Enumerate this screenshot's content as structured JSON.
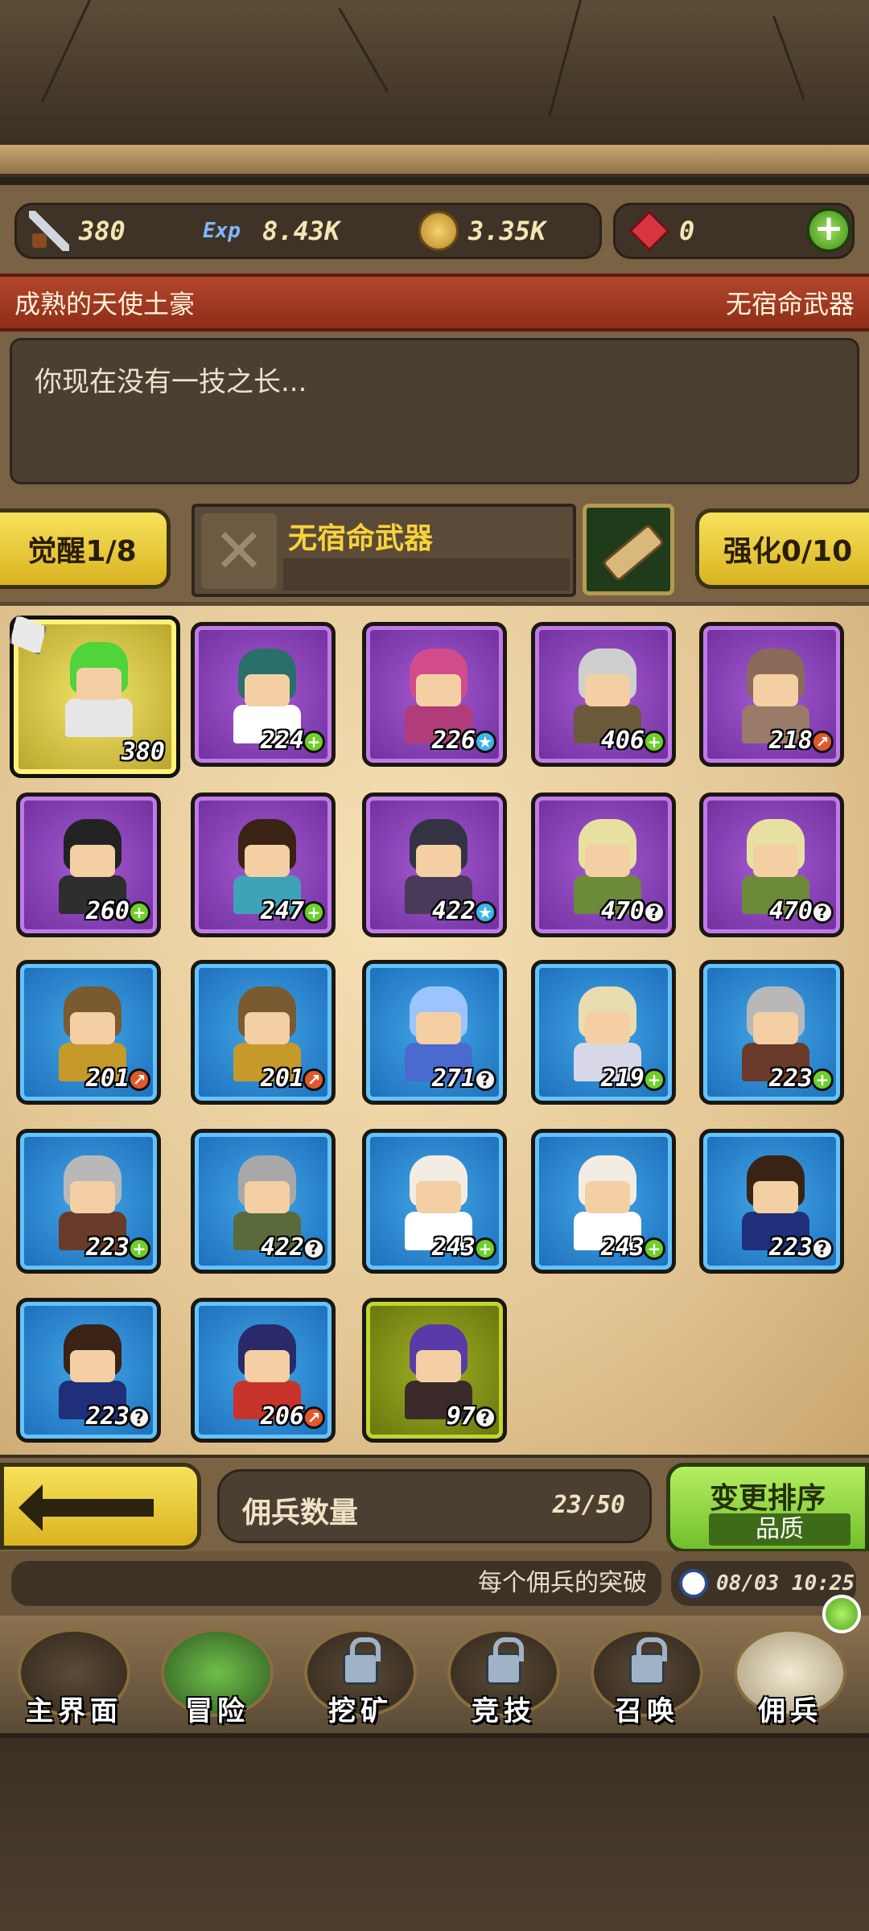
{
  "resources": {
    "power": "380",
    "exp_icon_text": "Exp",
    "exp": "8.43K",
    "gold": "3.35K",
    "gems": "0",
    "add_label": "+"
  },
  "hero": {
    "name": "成熟的天使土豪",
    "weapon_status": "无宿命武器",
    "description": "你现在没有一技之长..."
  },
  "actions": {
    "awaken_label": "觉醒1/8",
    "weapon_name": "无宿命武器",
    "weapon_empty_symbol": "✕",
    "enhance_label": "强化0/10"
  },
  "mercenaries": [
    {
      "level": "380",
      "rarity": "gold",
      "badge": "none",
      "hair": "#4fd43a",
      "outfit": "#e6e6e6"
    },
    {
      "level": "224",
      "rarity": "purple",
      "badge": "plus",
      "hair": "#2a6f6a",
      "outfit": "#ffffff"
    },
    {
      "level": "226",
      "rarity": "purple",
      "badge": "star",
      "hair": "#d24c8c",
      "outfit": "#b03d7a"
    },
    {
      "level": "406",
      "rarity": "purple",
      "badge": "plus",
      "hair": "#cfcfcf",
      "outfit": "#6a5a3a"
    },
    {
      "level": "218",
      "rarity": "purple",
      "badge": "leaf",
      "hair": "#8a6a5a",
      "outfit": "#9a7a68"
    },
    {
      "level": "260",
      "rarity": "purple",
      "badge": "plus",
      "hair": "#222222",
      "outfit": "#2e2e2e"
    },
    {
      "level": "247",
      "rarity": "purple",
      "badge": "plus",
      "hair": "#3a2214",
      "outfit": "#3fa3b8"
    },
    {
      "level": "422",
      "rarity": "purple",
      "badge": "star",
      "hair": "#333344",
      "outfit": "#4a3a5a"
    },
    {
      "level": "470",
      "rarity": "purple",
      "badge": "q",
      "hair": "#e8e0a0",
      "outfit": "#6c8a3a"
    },
    {
      "level": "470",
      "rarity": "purple",
      "badge": "q",
      "hair": "#e8e0a0",
      "outfit": "#6c8a3a"
    },
    {
      "level": "201",
      "rarity": "blue",
      "badge": "leaf",
      "hair": "#7a5a30",
      "outfit": "#c59a2a"
    },
    {
      "level": "201",
      "rarity": "blue",
      "badge": "leaf",
      "hair": "#7a5a30",
      "outfit": "#c59a2a"
    },
    {
      "level": "271",
      "rarity": "blue",
      "badge": "q",
      "hair": "#9cc4ff",
      "outfit": "#4a6ad0"
    },
    {
      "level": "219",
      "rarity": "blue",
      "badge": "plus",
      "hair": "#e8dcb0",
      "outfit": "#d8d8e8"
    },
    {
      "level": "223",
      "rarity": "blue",
      "badge": "plus",
      "hair": "#b8b8b8",
      "outfit": "#6a3a2a"
    },
    {
      "level": "223",
      "rarity": "blue",
      "badge": "plus",
      "hair": "#b8b8b8",
      "outfit": "#6a3a2a"
    },
    {
      "level": "422",
      "rarity": "blue",
      "badge": "q",
      "hair": "#a8a8a8",
      "outfit": "#5a6a3a"
    },
    {
      "level": "243",
      "rarity": "blue",
      "badge": "plus",
      "hair": "#f2ece2",
      "outfit": "#ffffff"
    },
    {
      "level": "243",
      "rarity": "blue",
      "badge": "plus",
      "hair": "#f2ece2",
      "outfit": "#ffffff"
    },
    {
      "level": "223",
      "rarity": "blue",
      "badge": "q",
      "hair": "#3a2214",
      "outfit": "#1f2f7a"
    },
    {
      "level": "223",
      "rarity": "blue",
      "badge": "q",
      "hair": "#3a2214",
      "outfit": "#1f2f7a"
    },
    {
      "level": "206",
      "rarity": "blue",
      "badge": "leaf",
      "hair": "#2a2a6a",
      "outfit": "#c8342a"
    },
    {
      "level": "97",
      "rarity": "olive",
      "badge": "q",
      "hair": "#5a3aa8",
      "outfit": "#3a2a2a"
    }
  ],
  "badge_symbols": {
    "plus": "+",
    "star": "★",
    "leaf": "↗",
    "q": "?"
  },
  "footer": {
    "count_label": "佣兵数量",
    "count_value": "23/50",
    "sort_label": "变更排序",
    "sort_mode": "品质"
  },
  "info": {
    "ticker": "每个佣兵的突破",
    "time": "08/03 10:25"
  },
  "nav": [
    {
      "label": "主界面"
    },
    {
      "label": "冒险"
    },
    {
      "label": "挖矿"
    },
    {
      "label": "竞技"
    },
    {
      "label": "召唤"
    },
    {
      "label": "佣兵"
    }
  ]
}
